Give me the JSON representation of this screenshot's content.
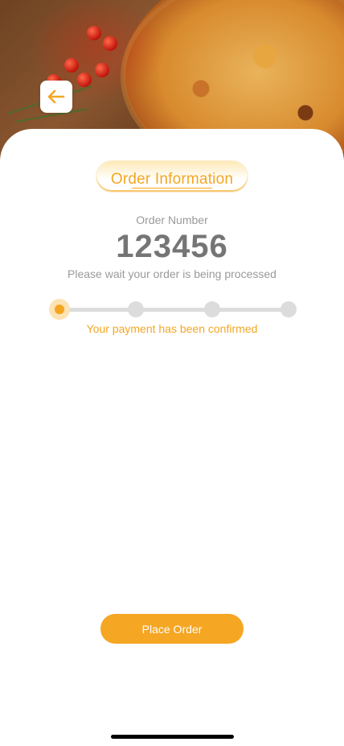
{
  "header": {
    "back_icon": "arrow-left-icon",
    "accent_color": "#F5A623"
  },
  "tab": {
    "label": "Order Information"
  },
  "order": {
    "number_label": "Order Number",
    "number": "123456",
    "wait_message": "Please wait your order is being processed"
  },
  "progress": {
    "total_steps": 4,
    "current_step": 1,
    "status": "Your payment has been confirmed"
  },
  "actions": {
    "place_order_label": "Place Order"
  }
}
